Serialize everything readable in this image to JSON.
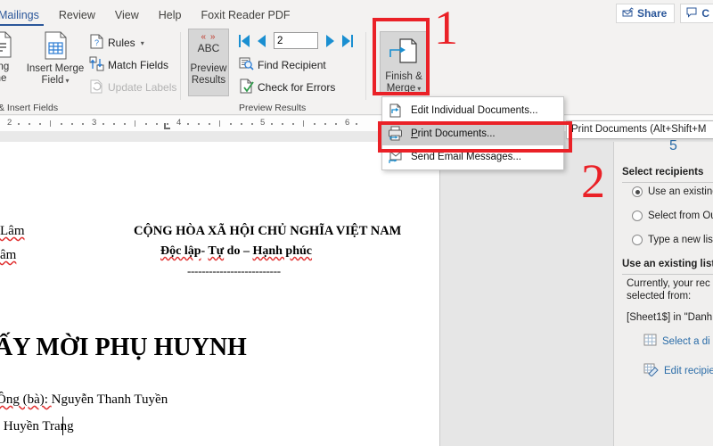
{
  "window": {
    "tabs": [
      {
        "label": "Mailings",
        "active": true
      },
      {
        "label": "Review",
        "active": false
      },
      {
        "label": "View",
        "active": false
      },
      {
        "label": "Help",
        "active": false
      },
      {
        "label": "Foxit Reader PDF",
        "active": false
      }
    ],
    "share_label": "Share",
    "comments_label": "C"
  },
  "ribbon": {
    "groups": [
      {
        "label": "& Insert Fields"
      },
      {
        "label": "Preview Results"
      }
    ],
    "write_insert": {
      "greeting_line_label_1": "ting",
      "greeting_line_label_2": "ne",
      "insert_merge_field_label_1": "Insert Merge",
      "insert_merge_field_label_2": "Field",
      "rules_label": "Rules",
      "match_fields_label": "Match Fields",
      "update_labels_label": "Update Labels"
    },
    "preview": {
      "preview_results_abc": "ABC",
      "preview_results_label_1": "Preview",
      "preview_results_label_2": "Results",
      "record_number": "2",
      "find_recipient_label": "Find Recipient",
      "check_for_errors_label": "Check for Errors"
    },
    "finish": {
      "finish_merge_label_1": "Finish &",
      "finish_merge_label_2": "Merge"
    }
  },
  "menu": {
    "items": [
      {
        "label": "Edit Individual Documents...",
        "icon": "edit-documents-icon",
        "highlighted": false
      },
      {
        "label": "Print Documents...",
        "icon": "printer-icon",
        "highlighted": true
      },
      {
        "label": "Send Email Messages...",
        "icon": "email-icon",
        "highlighted": false
      }
    ]
  },
  "tooltip": {
    "text": "Print Documents (Alt+Shift+M"
  },
  "ruler": {
    "marks": [
      "2",
      "3",
      "4",
      "5",
      "6"
    ]
  },
  "document": {
    "left_line_1": "Lâm",
    "left_line_2": "âm",
    "header_line_1": "CỘNG HÒA XÃ HỘI CHỦ NGHĨA VIỆT NAM",
    "header_line_2_a": "Độc lập",
    "header_line_2_b": "- ",
    "header_line_2_c": "Tự",
    "header_line_2_d": " do – ",
    "header_line_2_e": "Hạnh phúc",
    "header_divider": "--------------------------",
    "title": "ẤY MỜI PHỤ HUYNH",
    "recipient_label": "Ông (bà): ",
    "recipient_name": "Nguyễn Thanh Tuyền",
    "student_line": "ị Huyền Trang"
  },
  "task_pane": {
    "step_indicator": "5",
    "select_recipients_heading": "Select recipients",
    "options": [
      {
        "label": "Use an existing",
        "selected": true
      },
      {
        "label": "Select from Ou",
        "selected": false
      },
      {
        "label": "Type a new list",
        "selected": false
      }
    ],
    "use_existing_heading": "Use an existing list",
    "body_line_1": "Currently, your rec",
    "body_line_2": "selected from:",
    "source_line": "[Sheet1$] in \"Danh",
    "links": [
      {
        "label": "Select a di",
        "icon": "grid-table-icon"
      },
      {
        "label": "Edit recipie",
        "icon": "edit-list-icon"
      }
    ]
  },
  "annotations": {
    "marker_1": "1",
    "marker_2": "2",
    "color": "#ea2127"
  }
}
